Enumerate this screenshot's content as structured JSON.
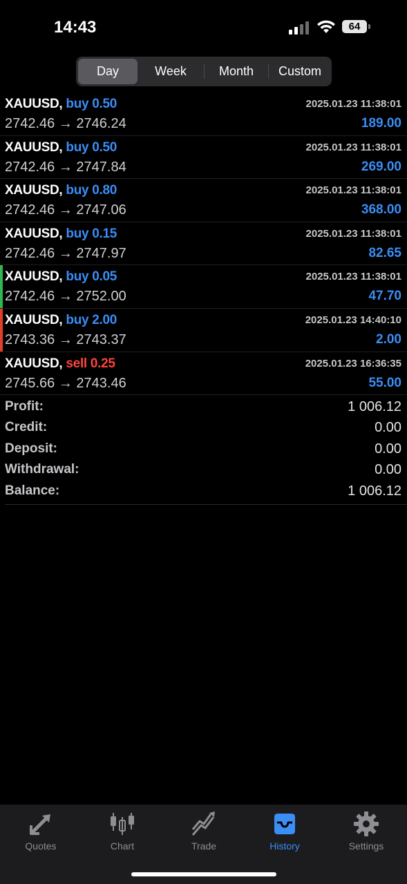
{
  "status_bar": {
    "time": "14:43",
    "battery": "64"
  },
  "segments": [
    {
      "label": "Day",
      "active": true
    },
    {
      "label": "Week",
      "active": false
    },
    {
      "label": "Month",
      "active": false
    },
    {
      "label": "Custom",
      "active": false
    }
  ],
  "deals": [
    {
      "symbol": "XAUUSD,",
      "direction": "buy",
      "volume": "0.50",
      "date": "2025.01.23 11:38:01",
      "prices": "2742.46 → 2746.24",
      "profit": "189.00"
    },
    {
      "symbol": "XAUUSD,",
      "direction": "buy",
      "volume": "0.50",
      "date": "2025.01.23 11:38:01",
      "prices": "2742.46 → 2747.84",
      "profit": "269.00"
    },
    {
      "symbol": "XAUUSD,",
      "direction": "buy",
      "volume": "0.80",
      "date": "2025.01.23 11:38:01",
      "prices": "2742.46 → 2747.06",
      "profit": "368.00"
    },
    {
      "symbol": "XAUUSD,",
      "direction": "buy",
      "volume": "0.15",
      "date": "2025.01.23 11:38:01",
      "prices": "2742.46 → 2747.97",
      "profit": "82.65"
    },
    {
      "symbol": "XAUUSD,",
      "direction": "buy",
      "volume": "0.05",
      "date": "2025.01.23 11:38:01",
      "prices": "2742.46 → 2752.00",
      "profit": "47.70"
    },
    {
      "symbol": "XAUUSD,",
      "direction": "buy",
      "volume": "2.00",
      "date": "2025.01.23 14:40:10",
      "prices": "2743.36 → 2743.37",
      "profit": "2.00"
    },
    {
      "symbol": "XAUUSD,",
      "direction": "sell",
      "volume": "0.25",
      "date": "2025.01.23 16:36:35",
      "prices": "2745.66 → 2743.46",
      "profit": "55.00"
    }
  ],
  "summary": [
    {
      "label": "Profit:",
      "value": "1 006.12"
    },
    {
      "label": "Credit:",
      "value": "0.00"
    },
    {
      "label": "Deposit:",
      "value": "0.00"
    },
    {
      "label": "Withdrawal:",
      "value": "0.00"
    },
    {
      "label": "Balance:",
      "value": "1 006.12"
    }
  ],
  "tabs": [
    {
      "label": "Quotes",
      "icon": "quotes-icon",
      "active": false
    },
    {
      "label": "Chart",
      "icon": "chart-icon",
      "active": false
    },
    {
      "label": "Trade",
      "icon": "trade-icon",
      "active": false
    },
    {
      "label": "History",
      "icon": "history-icon",
      "active": true
    },
    {
      "label": "Settings",
      "icon": "settings-icon",
      "active": false
    }
  ],
  "colors": {
    "buy": "#3a8ef6",
    "sell": "#ff453a",
    "profit": "#3a8ef6",
    "marker_green": "#2fb84e",
    "marker_red": "#e0402a",
    "tab_active": "#3a8ef6",
    "tab_inactive": "#8e8e93"
  }
}
